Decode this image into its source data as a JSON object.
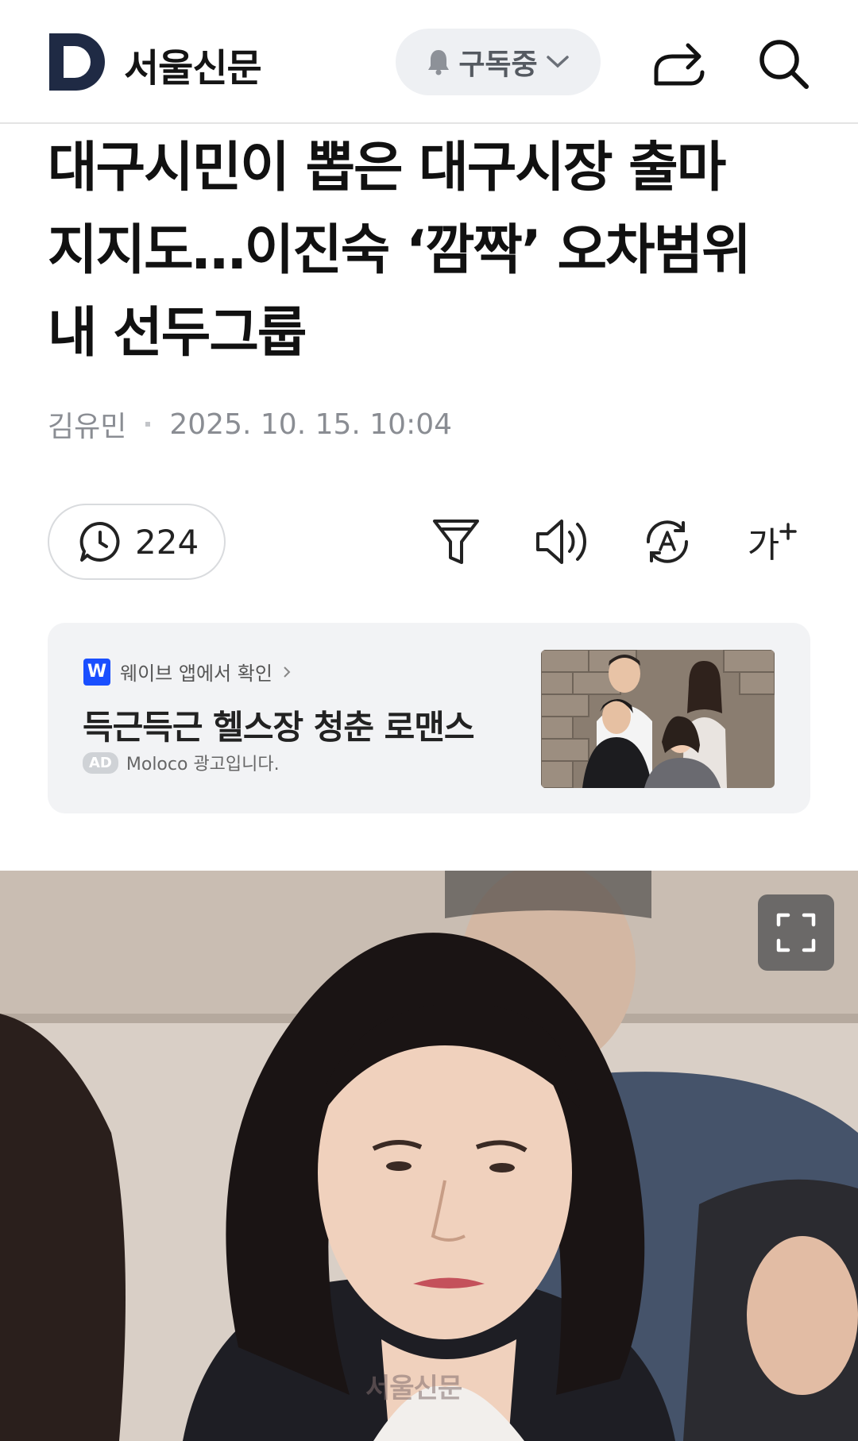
{
  "header": {
    "brand": "서울신문",
    "subscribe_label": "구독중",
    "icons": [
      "logo-d-icon",
      "bell-icon",
      "chevron-down-icon",
      "share-icon",
      "search-icon"
    ]
  },
  "article": {
    "headline_lines": [
      "대구시민이 뽑은 대구시장 출마",
      "지지도…이진숙 ‘깜짝’ 오차범위",
      "내 선두그룹"
    ],
    "author": "김유민",
    "datetime": "2025. 10. 15. 10:04"
  },
  "toolbar": {
    "comment_count": "224",
    "font_size_label": "가",
    "icons": [
      "comment-icon",
      "filter-icon",
      "speaker-icon",
      "translate-icon",
      "font-size-icon"
    ]
  },
  "ad": {
    "source_badge": "W",
    "source_label": "웨이브 앱에서 확인",
    "title": "득근득근 헬스장 청춘 로맨스",
    "ad_chip": "AD",
    "sponsor": "Moloco 광고입니다."
  },
  "photo": {
    "watermark": "서울신문",
    "expand_icon": "expand-icon"
  },
  "colors": {
    "brand_navy": "#1f2a44",
    "text_primary": "#111111",
    "text_meta": "#8a8d93",
    "pill_bg": "#eef0f3",
    "ad_bg": "#f2f3f5",
    "ad_badge_blue": "#1a4fff"
  }
}
